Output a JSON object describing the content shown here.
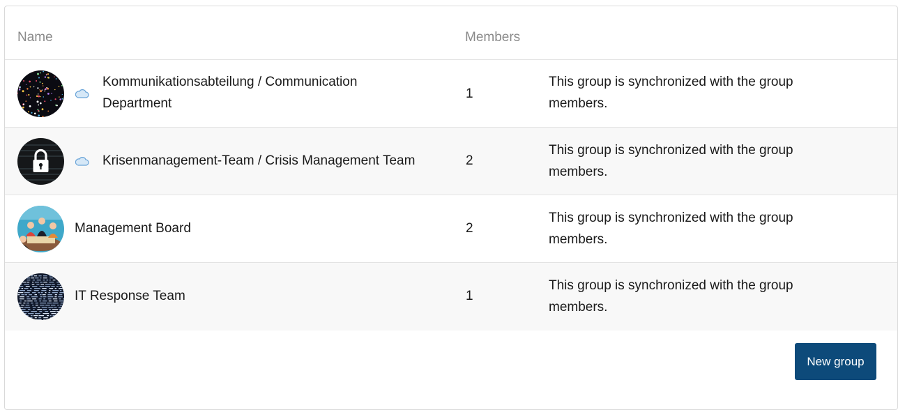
{
  "table": {
    "headers": {
      "name": "Name",
      "members": "Members"
    },
    "rows": [
      {
        "name_line1": "Kommunikationsabteilung / Communication",
        "name_line2": "Department",
        "members": "1",
        "desc_line1": "This group is synchronized with the group",
        "desc_line2": "members.",
        "synced_icon": "cloud-icon",
        "avatar": "confetti-avatar"
      },
      {
        "name_line1": "Krisenmanagement-Team / Crisis Management Team",
        "members": "2",
        "desc_line1": "This group is synchronized with the group",
        "desc_line2": "members.",
        "synced_icon": "cloud-icon",
        "avatar": "padlock-avatar"
      },
      {
        "name_line1": "Management Board",
        "members": "2",
        "desc_line1": "This group is synchronized with the group",
        "desc_line2": "members.",
        "avatar": "meeting-avatar"
      },
      {
        "name_line1": "IT Response Team",
        "members": "1",
        "desc_line1": "This group is synchronized with the group",
        "desc_line2": "members.",
        "avatar": "code-avatar"
      }
    ]
  },
  "actions": {
    "new_group_label": "New group"
  },
  "colors": {
    "primary_button": "#0d4a7a",
    "header_text": "#8a8a8a",
    "cloud_fill": "#d6e8f7",
    "cloud_stroke": "#6aa4d8"
  }
}
